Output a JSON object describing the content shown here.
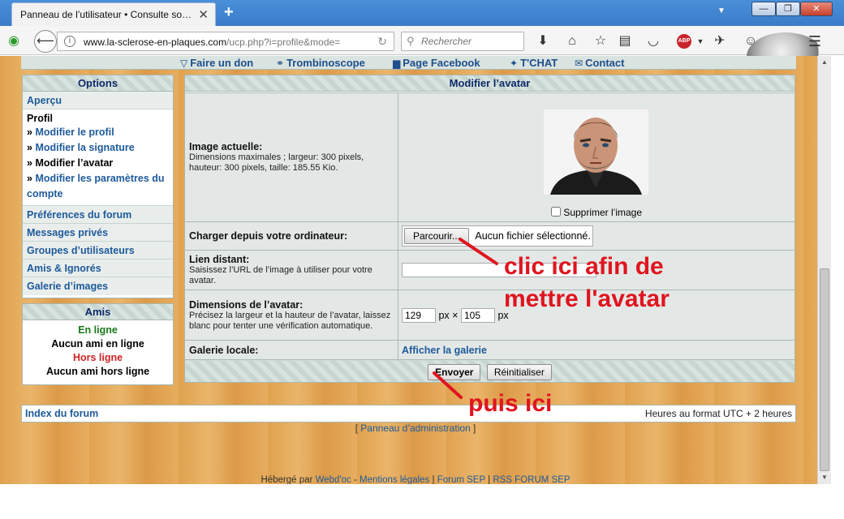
{
  "browser": {
    "tab_title": "Panneau de l’utilisateur • Consulte son…",
    "url_host": "www.la-sclerose-en-plaques.com",
    "url_path": "/ucp.php?i=profile&mode=",
    "search_placeholder": "Rechercher",
    "adblock_label": "ABP",
    "badge_count": "0"
  },
  "toplinks": [
    "Faire un don",
    "Trombinoscope",
    "Page Facebook",
    "T'CHAT",
    "Contact"
  ],
  "sidebar": {
    "options_title": "Options",
    "apercu": "Aperçu",
    "profil_title": "Profil",
    "profil_links": [
      "Modifier le profil",
      "Modifier la signature",
      "Modifier l’avatar",
      "Modifier les paramètres du compte"
    ],
    "sections": [
      "Préférences du forum",
      "Messages privés",
      "Groupes d’utilisateurs",
      "Amis & Ignorés",
      "Galerie d’images"
    ],
    "amis_title": "Amis",
    "en_ligne": "En ligne",
    "aucun_en_ligne": "Aucun ami en ligne",
    "hors_ligne": "Hors ligne",
    "aucun_hors_ligne": "Aucun ami hors ligne"
  },
  "avatar_panel": {
    "title": "Modifier l’avatar",
    "current_label": "Image actuelle:",
    "current_desc": "Dimensions maximales ; largeur: 300 pixels, hauteur: 300 pixels, taille: 185.55 Kio.",
    "delete_label": "Supprimer l’image",
    "upload_label": "Charger depuis votre ordinateur:",
    "browse_button": "Parcourir...",
    "no_file": "Aucun fichier sélectionné.",
    "remote_label": "Lien distant:",
    "remote_desc": "Saisissez l’URL de l’image à utiliser pour votre avatar.",
    "remote_value": "",
    "dims_label": "Dimensions de l’avatar:",
    "dims_desc": "Précisez la largeur et la hauteur de l’avatar, laissez blanc pour tenter une vérification automatique.",
    "width_value": "129",
    "height_value": "105",
    "px_unit": "px",
    "times_sign": "×",
    "gallery_label": "Galerie locale:",
    "gallery_link": "Afficher la galerie",
    "submit_button": "Envoyer",
    "reset_button": "Réinitialiser"
  },
  "footer": {
    "index_link": "Index du forum",
    "timezone": "Heures au format UTC + 2 heures",
    "admin_bracket_open": "[",
    "admin_link": "Panneau d’administration",
    "admin_bracket_close": "]",
    "hosted_by": "Hébergé par",
    "webdoc": "Webd'oc",
    "sep1": " - ",
    "mentions": "Mentions légales",
    "sep2": " | ",
    "forum_sep": "Forum SEP",
    "sep3": " | ",
    "rss": "RSS FORUM SEP"
  },
  "annotations": {
    "line1": "clic ici afin de",
    "line2": "mettre l'avatar",
    "line3": "puis ici",
    "color": "#e0141f"
  }
}
